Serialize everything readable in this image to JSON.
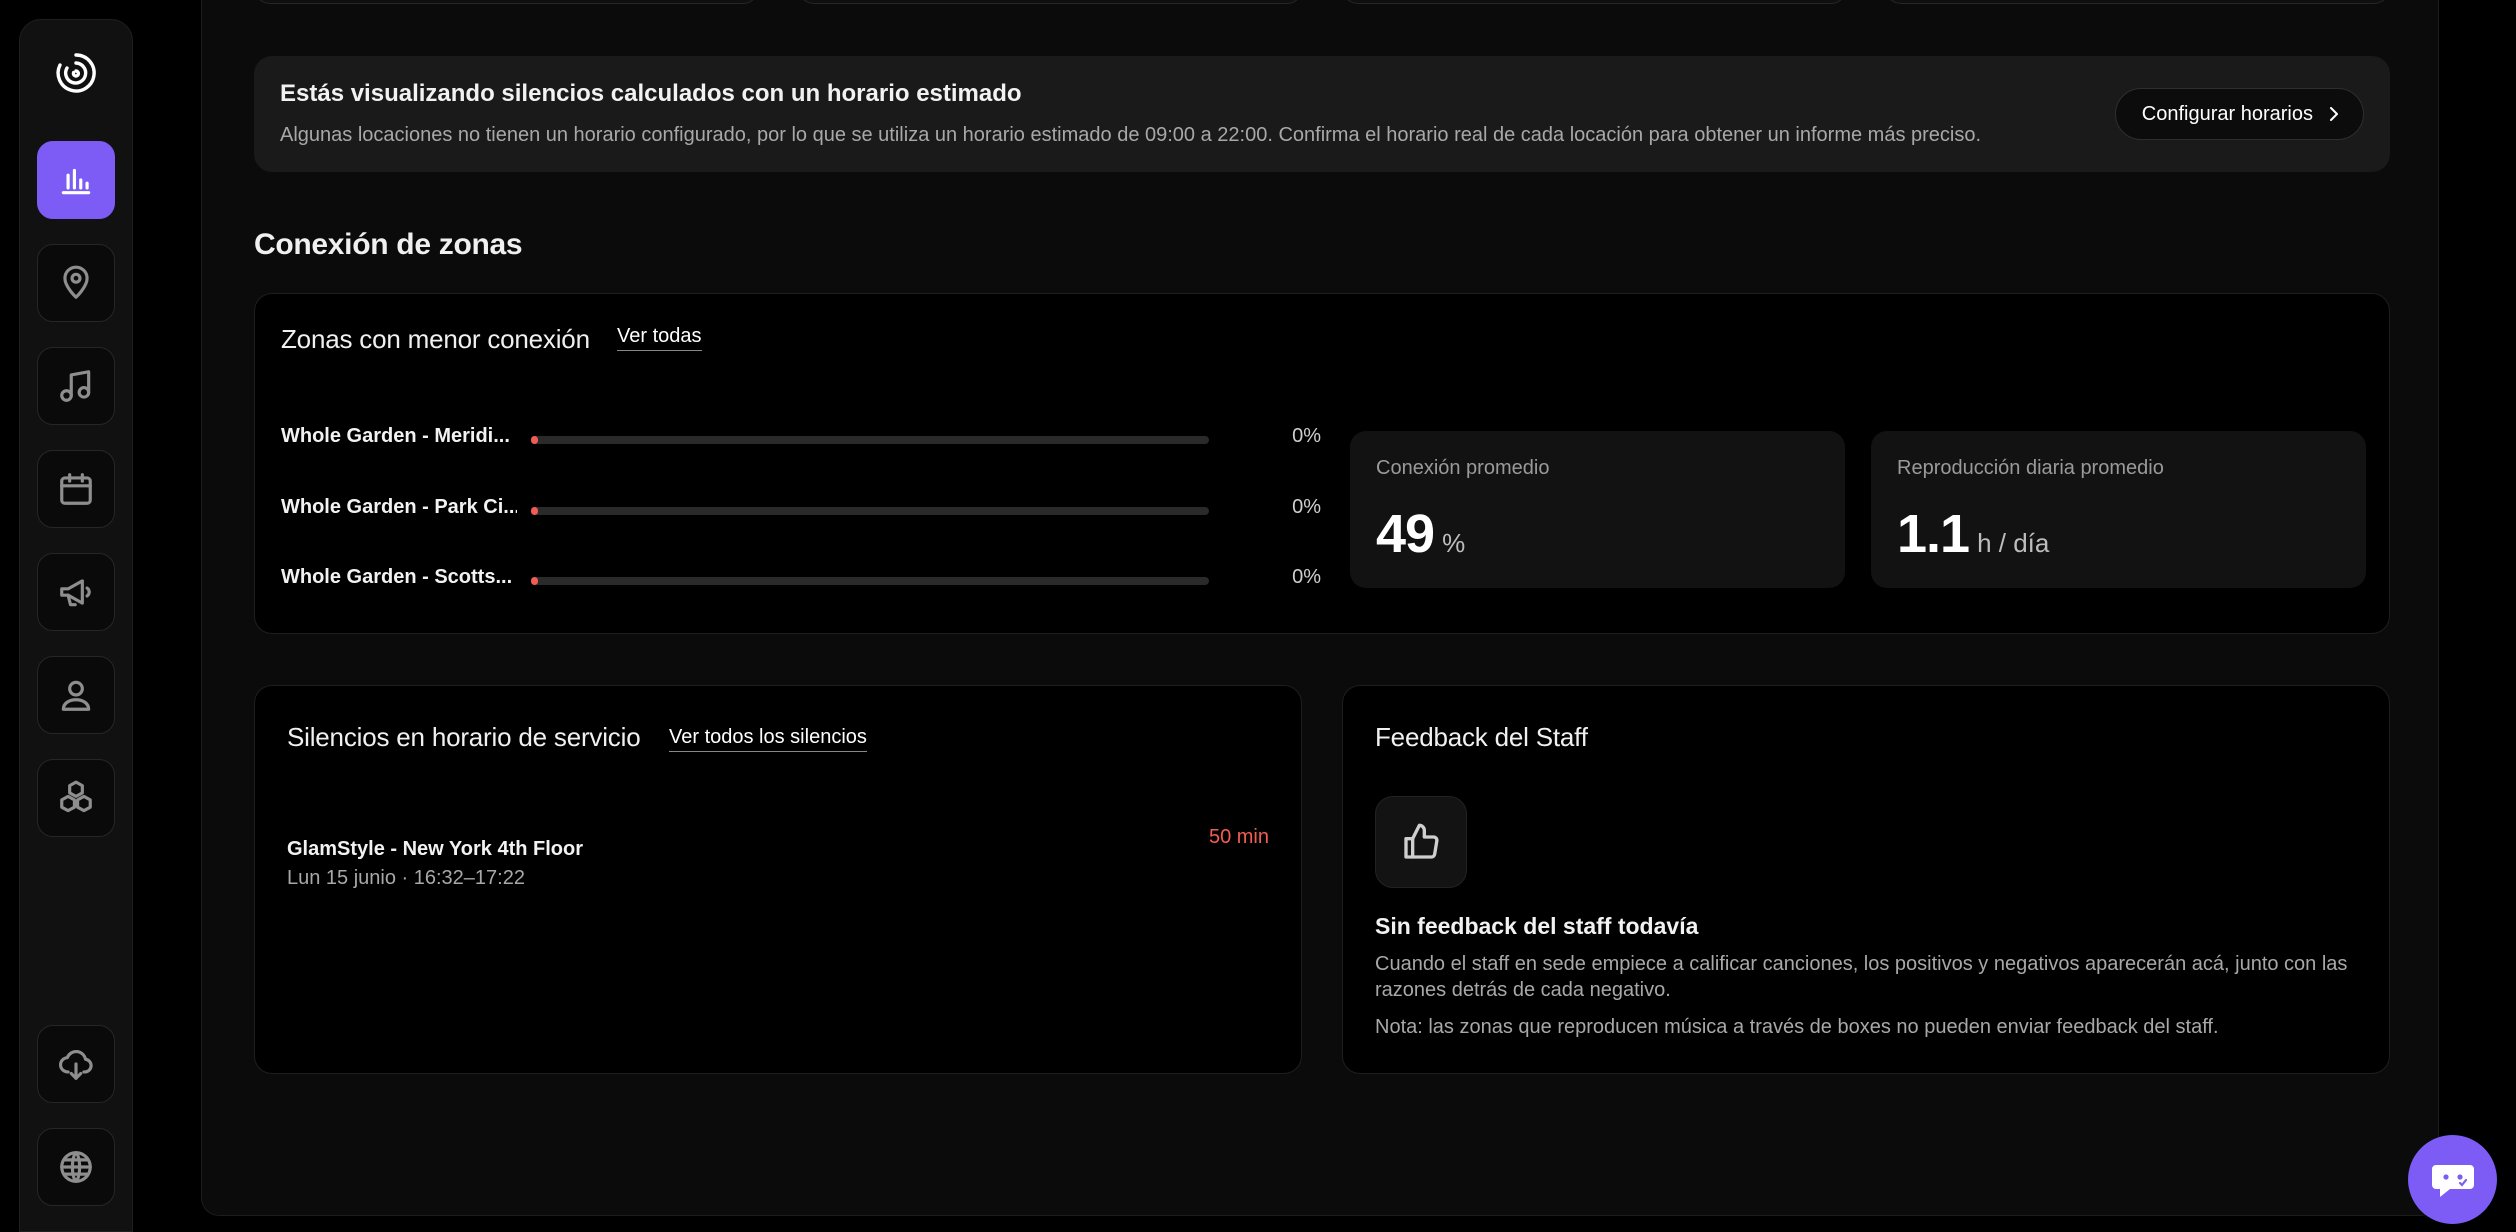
{
  "notice": {
    "title": "Estás visualizando silencios calculados con un horario estimado",
    "text": "Algunas locaciones no tienen un horario configurado, por lo que se utiliza un horario estimado de 09:00 a 22:00. Confirma el horario real de cada locación para obtener un informe más preciso.",
    "button": "Configurar horarios"
  },
  "section": {
    "title": "Conexión de zonas"
  },
  "zones": {
    "title": "Zonas con menor conexión",
    "link": "Ver todas",
    "rows": [
      {
        "name": "Whole Garden - Meridi...",
        "percent": "0%",
        "fill": 0
      },
      {
        "name": "Whole Garden - Park Ci...",
        "percent": "0%",
        "fill": 0
      },
      {
        "name": "Whole Garden - Scotts...",
        "percent": "0%",
        "fill": 0
      }
    ],
    "stats": [
      {
        "label": "Conexión promedio",
        "value": "49",
        "unit": "%"
      },
      {
        "label": "Reproducción diaria promedio",
        "value": "1.1",
        "unit": "h / día"
      }
    ]
  },
  "silences": {
    "title": "Silencios en horario de servicio",
    "link": "Ver todos los silencios",
    "items": [
      {
        "location": "GlamStyle - New York 4th Floor",
        "when": "Lun 15 junio · 16:32–17:22",
        "duration": "50 min"
      }
    ]
  },
  "feedback": {
    "title": "Feedback del Staff",
    "empty_title": "Sin feedback del staff todavía",
    "empty_text": "Cuando el staff en sede empiece a calificar canciones, los positivos y negativos aparecerán acá, junto con las razones detrás de cada negativo.",
    "note": "Nota: las zonas que reproducen música a través de boxes no pueden enviar feedback del staff."
  },
  "colors": {
    "accent": "#7c5cf5",
    "danger": "#f25c54"
  }
}
